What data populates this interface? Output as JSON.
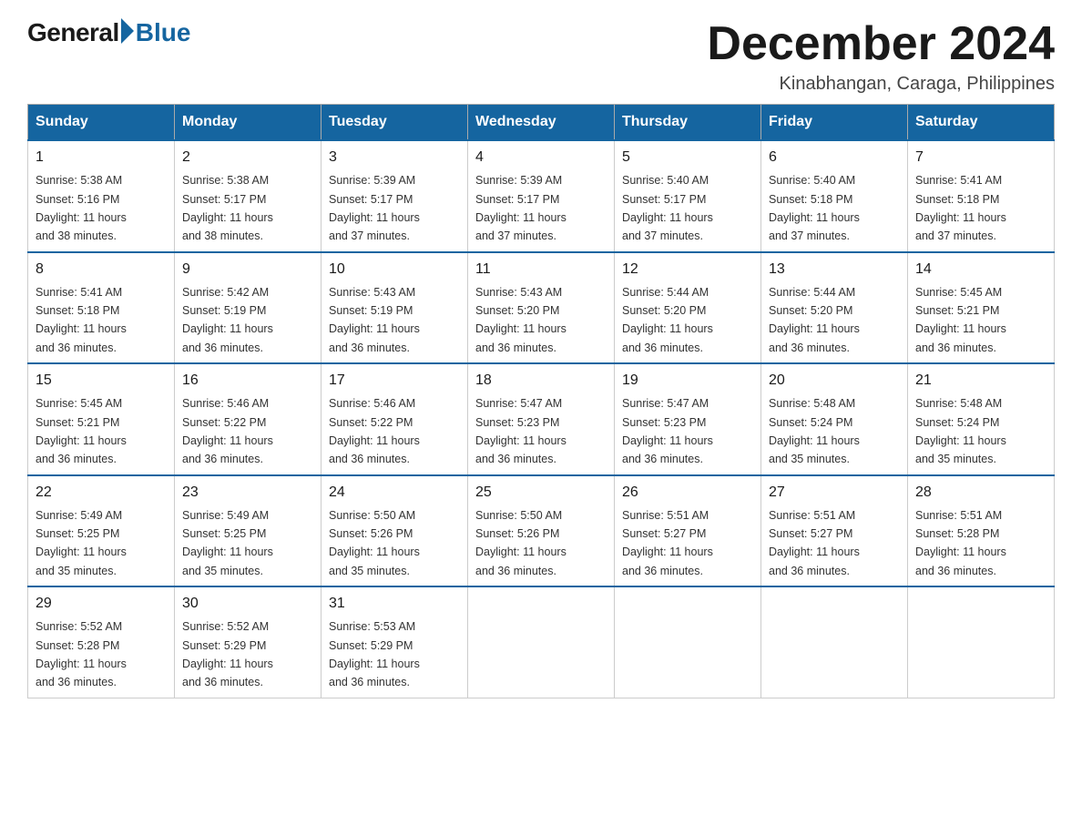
{
  "header": {
    "logo_general": "General",
    "logo_blue": "Blue",
    "month_title": "December 2024",
    "subtitle": "Kinabhangan, Caraga, Philippines"
  },
  "days_of_week": [
    "Sunday",
    "Monday",
    "Tuesday",
    "Wednesday",
    "Thursday",
    "Friday",
    "Saturday"
  ],
  "weeks": [
    [
      {
        "day": "1",
        "sunrise": "5:38 AM",
        "sunset": "5:16 PM",
        "daylight": "11 hours and 38 minutes."
      },
      {
        "day": "2",
        "sunrise": "5:38 AM",
        "sunset": "5:17 PM",
        "daylight": "11 hours and 38 minutes."
      },
      {
        "day": "3",
        "sunrise": "5:39 AM",
        "sunset": "5:17 PM",
        "daylight": "11 hours and 37 minutes."
      },
      {
        "day": "4",
        "sunrise": "5:39 AM",
        "sunset": "5:17 PM",
        "daylight": "11 hours and 37 minutes."
      },
      {
        "day": "5",
        "sunrise": "5:40 AM",
        "sunset": "5:17 PM",
        "daylight": "11 hours and 37 minutes."
      },
      {
        "day": "6",
        "sunrise": "5:40 AM",
        "sunset": "5:18 PM",
        "daylight": "11 hours and 37 minutes."
      },
      {
        "day": "7",
        "sunrise": "5:41 AM",
        "sunset": "5:18 PM",
        "daylight": "11 hours and 37 minutes."
      }
    ],
    [
      {
        "day": "8",
        "sunrise": "5:41 AM",
        "sunset": "5:18 PM",
        "daylight": "11 hours and 36 minutes."
      },
      {
        "day": "9",
        "sunrise": "5:42 AM",
        "sunset": "5:19 PM",
        "daylight": "11 hours and 36 minutes."
      },
      {
        "day": "10",
        "sunrise": "5:43 AM",
        "sunset": "5:19 PM",
        "daylight": "11 hours and 36 minutes."
      },
      {
        "day": "11",
        "sunrise": "5:43 AM",
        "sunset": "5:20 PM",
        "daylight": "11 hours and 36 minutes."
      },
      {
        "day": "12",
        "sunrise": "5:44 AM",
        "sunset": "5:20 PM",
        "daylight": "11 hours and 36 minutes."
      },
      {
        "day": "13",
        "sunrise": "5:44 AM",
        "sunset": "5:20 PM",
        "daylight": "11 hours and 36 minutes."
      },
      {
        "day": "14",
        "sunrise": "5:45 AM",
        "sunset": "5:21 PM",
        "daylight": "11 hours and 36 minutes."
      }
    ],
    [
      {
        "day": "15",
        "sunrise": "5:45 AM",
        "sunset": "5:21 PM",
        "daylight": "11 hours and 36 minutes."
      },
      {
        "day": "16",
        "sunrise": "5:46 AM",
        "sunset": "5:22 PM",
        "daylight": "11 hours and 36 minutes."
      },
      {
        "day": "17",
        "sunrise": "5:46 AM",
        "sunset": "5:22 PM",
        "daylight": "11 hours and 36 minutes."
      },
      {
        "day": "18",
        "sunrise": "5:47 AM",
        "sunset": "5:23 PM",
        "daylight": "11 hours and 36 minutes."
      },
      {
        "day": "19",
        "sunrise": "5:47 AM",
        "sunset": "5:23 PM",
        "daylight": "11 hours and 36 minutes."
      },
      {
        "day": "20",
        "sunrise": "5:48 AM",
        "sunset": "5:24 PM",
        "daylight": "11 hours and 35 minutes."
      },
      {
        "day": "21",
        "sunrise": "5:48 AM",
        "sunset": "5:24 PM",
        "daylight": "11 hours and 35 minutes."
      }
    ],
    [
      {
        "day": "22",
        "sunrise": "5:49 AM",
        "sunset": "5:25 PM",
        "daylight": "11 hours and 35 minutes."
      },
      {
        "day": "23",
        "sunrise": "5:49 AM",
        "sunset": "5:25 PM",
        "daylight": "11 hours and 35 minutes."
      },
      {
        "day": "24",
        "sunrise": "5:50 AM",
        "sunset": "5:26 PM",
        "daylight": "11 hours and 35 minutes."
      },
      {
        "day": "25",
        "sunrise": "5:50 AM",
        "sunset": "5:26 PM",
        "daylight": "11 hours and 36 minutes."
      },
      {
        "day": "26",
        "sunrise": "5:51 AM",
        "sunset": "5:27 PM",
        "daylight": "11 hours and 36 minutes."
      },
      {
        "day": "27",
        "sunrise": "5:51 AM",
        "sunset": "5:27 PM",
        "daylight": "11 hours and 36 minutes."
      },
      {
        "day": "28",
        "sunrise": "5:51 AM",
        "sunset": "5:28 PM",
        "daylight": "11 hours and 36 minutes."
      }
    ],
    [
      {
        "day": "29",
        "sunrise": "5:52 AM",
        "sunset": "5:28 PM",
        "daylight": "11 hours and 36 minutes."
      },
      {
        "day": "30",
        "sunrise": "5:52 AM",
        "sunset": "5:29 PM",
        "daylight": "11 hours and 36 minutes."
      },
      {
        "day": "31",
        "sunrise": "5:53 AM",
        "sunset": "5:29 PM",
        "daylight": "11 hours and 36 minutes."
      },
      null,
      null,
      null,
      null
    ]
  ],
  "labels": {
    "sunrise": "Sunrise:",
    "sunset": "Sunset:",
    "daylight": "Daylight:"
  },
  "colors": {
    "header_bg": "#1565a0",
    "header_text": "#ffffff",
    "border": "#cccccc",
    "row_border_top": "#1565a0"
  }
}
